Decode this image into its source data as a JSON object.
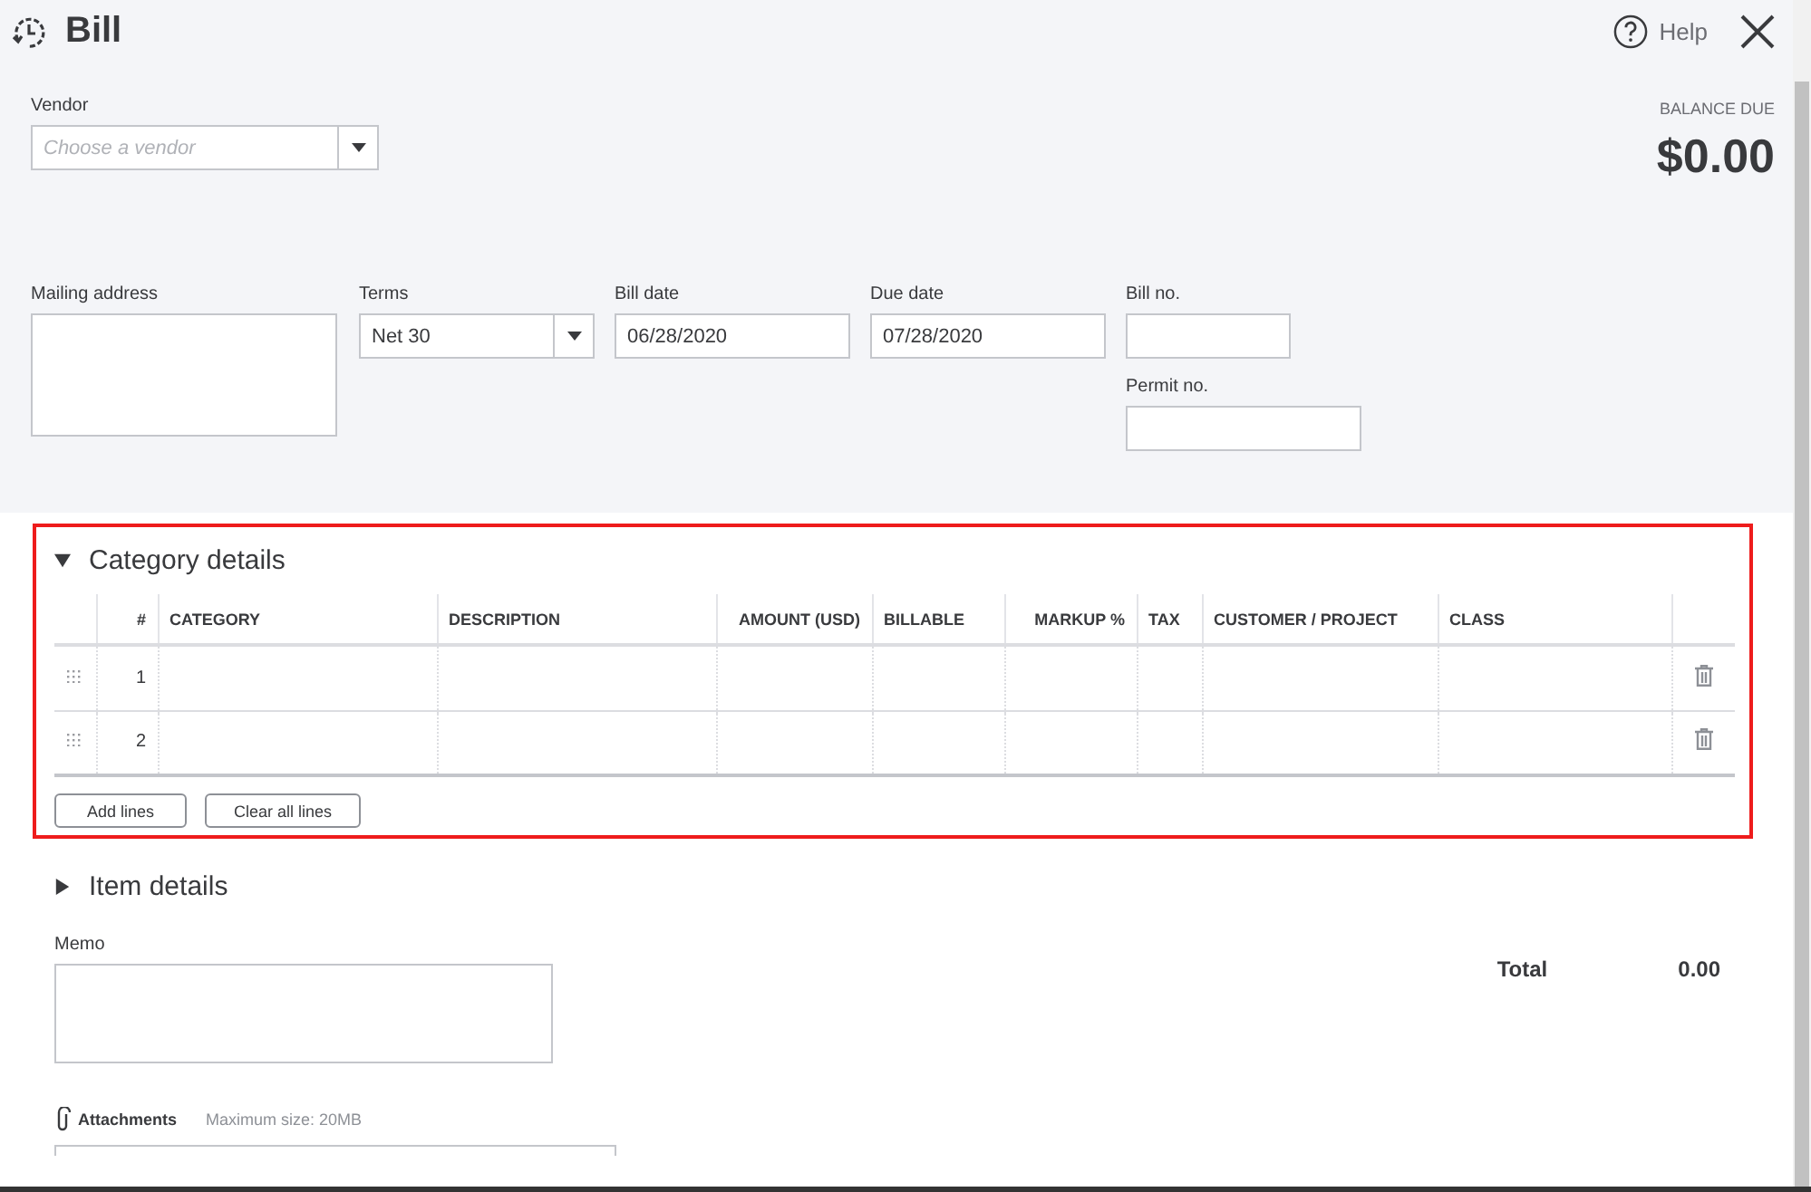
{
  "window": {
    "title": "Bill",
    "help": "Help"
  },
  "balance": {
    "label": "BALANCE DUE",
    "amount": "$0.00"
  },
  "vendor": {
    "label": "Vendor",
    "placeholder": "Choose a vendor"
  },
  "fields": [
    {
      "kind": "textarea",
      "label": "Mailing address"
    },
    {
      "kind": "select",
      "label": "Terms",
      "value": "Net 30"
    },
    {
      "kind": "text",
      "label": "Bill date",
      "value": "06/28/2020"
    },
    {
      "kind": "text",
      "label": "Due date",
      "value": "07/28/2020"
    },
    {
      "kind": "stack",
      "items": [
        {
          "label": "Bill no."
        },
        {
          "label": "Permit no."
        }
      ]
    }
  ],
  "category_details": {
    "title": "Category details",
    "expanded": true,
    "highlighted": true,
    "columns": [
      "#",
      "CATEGORY",
      "DESCRIPTION",
      "AMOUNT (USD)",
      "BILLABLE",
      "MARKUP %",
      "TAX",
      "CUSTOMER / PROJECT",
      "CLASS"
    ],
    "rows": [
      {
        "number": "1"
      },
      {
        "number": "2"
      }
    ],
    "buttons": [
      "Add lines",
      "Clear all lines"
    ]
  },
  "item_details": {
    "title": "Item details",
    "expanded": false
  },
  "memo": {
    "label": "Memo"
  },
  "total": {
    "label": "Total",
    "value": "0.00"
  },
  "attachments": {
    "label": "Attachments",
    "note": "Maximum size: 20MB"
  }
}
